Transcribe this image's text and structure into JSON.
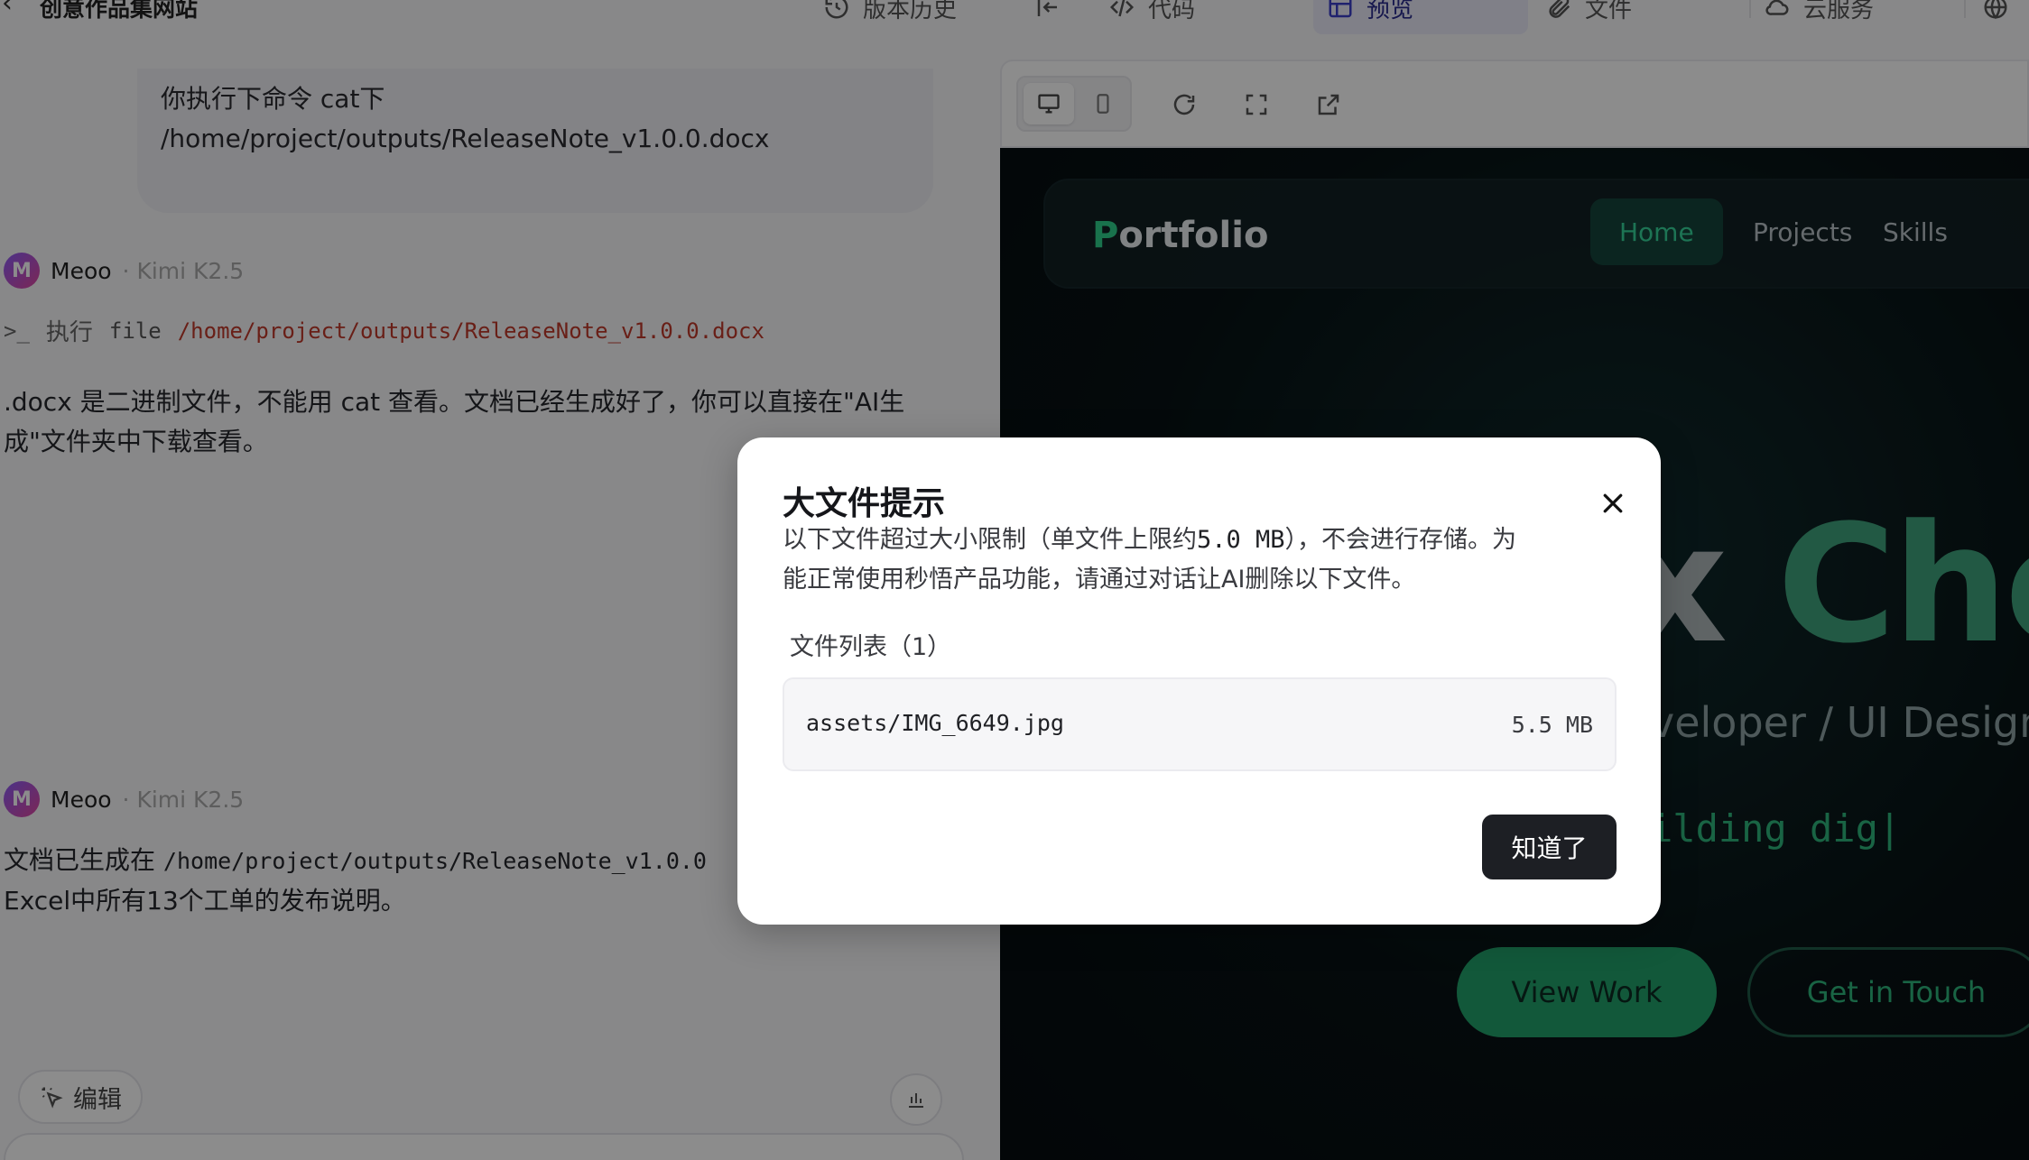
{
  "topbar": {
    "back_icon": "chevron-left-icon",
    "project_title": "创意作品集网站",
    "history_label": "版本历史",
    "code_label": "代码",
    "preview_label": "预览",
    "files_label": "文件",
    "cloud_label": "云服务"
  },
  "chat": {
    "user_message_line1": "你执行下命令 cat下",
    "user_message_line2": "/home/project/outputs/ReleaseNote_v1.0.0.docx",
    "messages": [
      {
        "avatar_text": "M",
        "name": "Meoo",
        "model": "· Kimi K2.5",
        "exec_label": "执行",
        "exec_cmd": "file",
        "exec_path": "/home/project/outputs/ReleaseNote_v1.0.0.docx",
        "text_line1": ".docx 是二进制文件，不能用 cat 查看。文档已经生成好了，你可以直接在\"AI生",
        "text_line2": "成\"文件夹中下载查看。"
      },
      {
        "avatar_text": "M",
        "name": "Meoo",
        "model": "· Kimi K2.5",
        "text_prefix": "文档已生成在",
        "text_code": "/home/project/outputs/ReleaseNote_v1.0.0",
        "text_line2": "Excel中所有13个工单的发布说明。"
      }
    ],
    "edit_label": "编辑"
  },
  "site": {
    "brand_first": "P",
    "brand_rest": "ortfolio",
    "nav": [
      "Home",
      "Projects",
      "Skills"
    ],
    "hero_title_a": "x ",
    "hero_title_b": "Che",
    "hero_sub": "veloper / UI Designe",
    "hero_typing": "ilding dig|",
    "btn_view": "View Work",
    "btn_touch": "Get in Touch"
  },
  "modal": {
    "title": "大文件提示",
    "desc_line1_a": "以下文件超过大小限制（单文件上限约",
    "desc_line1_code": "5.0 MB",
    "desc_line1_b": "），不会进行存储。为",
    "desc_line2": "能正常使用秒悟产品功能，请通过对话让AI删除以下文件。",
    "list_label": "文件列表（1）",
    "files": [
      {
        "name": "assets/IMG_6649.jpg",
        "size": "5.5 MB"
      }
    ],
    "ok_label": "知道了"
  },
  "colors": {
    "accent_green": "#2fd08b",
    "modal_button": "#1d1f24",
    "path_red": "#c0392b"
  }
}
